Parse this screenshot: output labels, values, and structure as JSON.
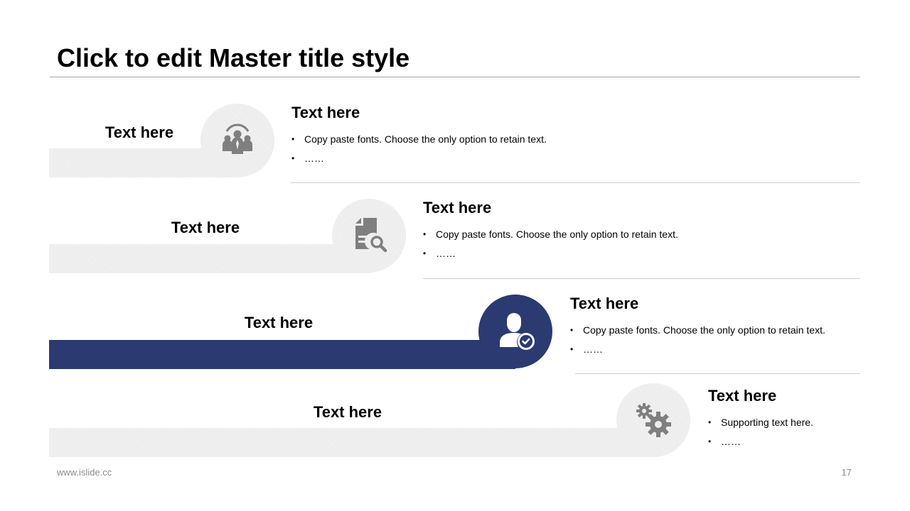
{
  "slide": {
    "title": "Click to edit Master title style",
    "footer_url": "www.islide.cc",
    "page_number": "17"
  },
  "rows": [
    {
      "bar_label": "Text here",
      "icon": "team-icon",
      "heading": "Text here",
      "bullets": [
        "Copy paste fonts. Choose the only option to retain text.",
        "……"
      ]
    },
    {
      "bar_label": "Text here",
      "icon": "document-search-icon",
      "heading": "Text here",
      "bullets": [
        "Copy paste fonts. Choose the only option to retain text.",
        "……"
      ]
    },
    {
      "bar_label": "Text here",
      "icon": "user-check-icon",
      "heading": "Text here",
      "bullets": [
        "Copy paste fonts. Choose the only option to retain text.",
        "……"
      ]
    },
    {
      "bar_label": "Text here",
      "icon": "gears-icon",
      "heading": "Text here",
      "bullets": [
        "Supporting text here.",
        "……"
      ]
    }
  ],
  "colors": {
    "accent": "#2b3a70",
    "inactive": "#ececec",
    "icon_gray": "#7f7f7f"
  }
}
